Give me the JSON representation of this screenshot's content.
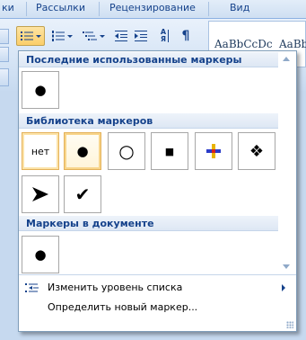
{
  "ribbon": {
    "tabs": [
      "ки",
      "Рассылки",
      "Рецензирование",
      "Вид"
    ],
    "styles_gallery": [
      "AaBbCcDc",
      "AaBbC"
    ],
    "buttons": [
      {
        "name": "bullets-button",
        "icon": "bullet-list-icon",
        "pressed": true
      },
      {
        "name": "numbering-button",
        "icon": "numbered-list-icon"
      },
      {
        "name": "multilevel-list-button",
        "icon": "multilevel-list-icon"
      },
      {
        "name": "decrease-indent-button",
        "icon": "decrease-indent-icon"
      },
      {
        "name": "increase-indent-button",
        "icon": "increase-indent-icon"
      },
      {
        "name": "sort-button",
        "icon": "sort-az-icon",
        "glyph": "А Я"
      },
      {
        "name": "show-formatting-button",
        "icon": "pilcrow-icon",
        "glyph": "¶"
      }
    ]
  },
  "panel": {
    "recent": {
      "title": "Последние использованные маркеры",
      "items": [
        {
          "name": "recent-bullet-dot",
          "symbol": "●"
        }
      ]
    },
    "library": {
      "title": "Библиотека маркеров",
      "items": [
        {
          "name": "bullet-none",
          "label": "нет"
        },
        {
          "name": "bullet-filled-circle",
          "symbol": "●",
          "selected": true
        },
        {
          "name": "bullet-hollow-circle",
          "symbol": "○"
        },
        {
          "name": "bullet-square",
          "symbol": "■"
        },
        {
          "name": "bullet-color-cross",
          "symbol": "✚"
        },
        {
          "name": "bullet-diamond-cluster",
          "symbol": "❖"
        },
        {
          "name": "bullet-arrowhead",
          "symbol": "➤"
        },
        {
          "name": "bullet-checkmark",
          "symbol": "✔"
        }
      ]
    },
    "document": {
      "title": "Маркеры в документе",
      "items": [
        {
          "name": "document-bullet-dot",
          "symbol": "●"
        }
      ]
    },
    "menu": {
      "change_level": "Изменить уровень списка",
      "define_new": "Определить новый маркер..."
    }
  },
  "colors": {
    "accent": "#15428b",
    "selected_border": "#e3b15a",
    "ribbon_bg": "#d5e4f5"
  }
}
